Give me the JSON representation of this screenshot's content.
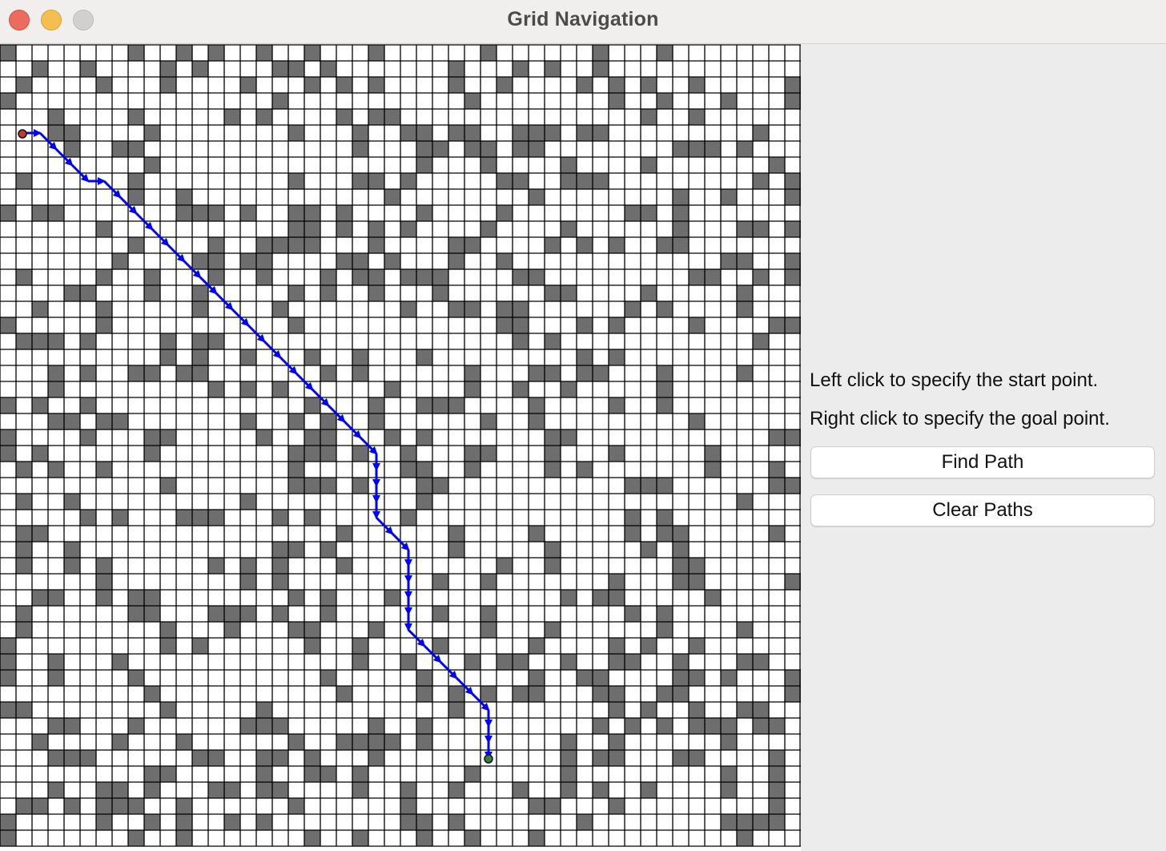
{
  "window": {
    "title": "Grid Navigation",
    "buttons": [
      "close",
      "minimize",
      "zoom"
    ]
  },
  "grid": {
    "cols": 50,
    "rows": 50,
    "colors": {
      "free": "#ffffff",
      "obstacle": "#6e6e6e",
      "line": "#000000",
      "path": "#0000ff",
      "start": "#c0392b",
      "goal": "#3b7d3b"
    },
    "obstacles": [
      "...........................",
      "",
      "",
      ""
    ],
    "start_cell": [
      1,
      5
    ],
    "goal_cell": [
      30,
      44
    ],
    "path_cells": [
      [
        1,
        5
      ],
      [
        2,
        5
      ],
      [
        3,
        6
      ],
      [
        4,
        7
      ],
      [
        5,
        8
      ],
      [
        6,
        8
      ],
      [
        7,
        9
      ],
      [
        8,
        10
      ],
      [
        9,
        11
      ],
      [
        10,
        12
      ],
      [
        11,
        13
      ],
      [
        12,
        14
      ],
      [
        13,
        15
      ],
      [
        14,
        16
      ],
      [
        15,
        17
      ],
      [
        16,
        18
      ],
      [
        17,
        19
      ],
      [
        18,
        20
      ],
      [
        19,
        21
      ],
      [
        20,
        22
      ],
      [
        21,
        23
      ],
      [
        22,
        24
      ],
      [
        23,
        25
      ],
      [
        23,
        26
      ],
      [
        23,
        27
      ],
      [
        23,
        28
      ],
      [
        23,
        29
      ],
      [
        24,
        30
      ],
      [
        25,
        31
      ],
      [
        25,
        32
      ],
      [
        25,
        33
      ],
      [
        25,
        34
      ],
      [
        25,
        35
      ],
      [
        25,
        36
      ],
      [
        26,
        37
      ],
      [
        27,
        38
      ],
      [
        28,
        39
      ],
      [
        29,
        40
      ],
      [
        30,
        41
      ],
      [
        30,
        42
      ],
      [
        30,
        43
      ],
      [
        30,
        44
      ]
    ]
  },
  "sidebar": {
    "instruction_start": "Left click to specify the start point.",
    "instruction_goal": "Right click to specify the goal point.",
    "find_path_label": "Find Path",
    "clear_paths_label": "Clear Paths"
  }
}
